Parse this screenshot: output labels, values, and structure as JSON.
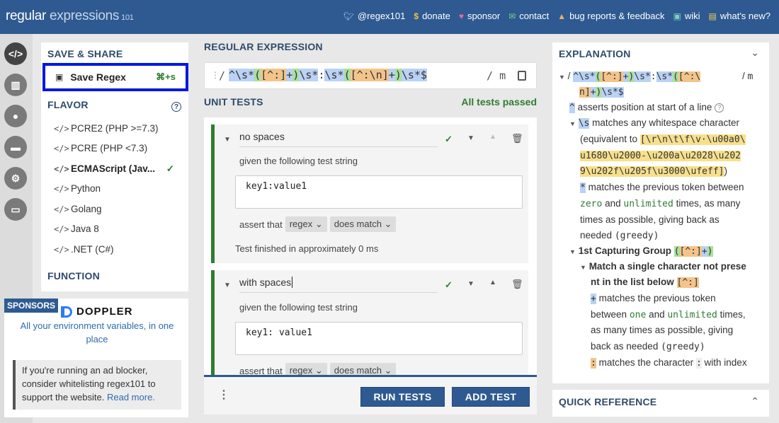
{
  "header": {
    "logo_main": "regular",
    "logo_second": "expressions",
    "logo_version": "101",
    "nav": [
      {
        "icon": "twitter-icon",
        "label": "@regex101"
      },
      {
        "icon": "dollar-icon",
        "label": "donate"
      },
      {
        "icon": "heart-icon",
        "label": "sponsor"
      },
      {
        "icon": "mail-icon",
        "label": "contact"
      },
      {
        "icon": "warning-icon",
        "label": "bug reports & feedback"
      },
      {
        "icon": "wiki-icon",
        "label": "wiki"
      },
      {
        "icon": "whatsnew-icon",
        "label": "what's new?"
      }
    ]
  },
  "left": {
    "save_title": "SAVE & SHARE",
    "save_label": "Save Regex",
    "save_shortcut": "⌘+s",
    "flavor_title": "FLAVOR",
    "flavors": [
      {
        "label": "PCRE2 (PHP >=7.3)",
        "selected": false
      },
      {
        "label": "PCRE (PHP <7.3)",
        "selected": false
      },
      {
        "label": "ECMAScript (Jav...",
        "selected": true
      },
      {
        "label": "Python",
        "selected": false
      },
      {
        "label": "Golang",
        "selected": false
      },
      {
        "label": "Java 8",
        "selected": false
      },
      {
        "label": ".NET (C#)",
        "selected": false
      }
    ],
    "function_title": "FUNCTION"
  },
  "sponsors": {
    "tag": "SPONSORS",
    "brand": "DOPPLER",
    "tagline": "All your environment variables, in one place",
    "adblock_text": "If you're running an ad blocker, consider whitelisting regex101 to support the website.",
    "read_more": "Read more."
  },
  "regex": {
    "title": "REGULAR EXPRESSION",
    "delimiter_open": "/",
    "delimiter_close": "/",
    "flags": "m"
  },
  "unit_tests": {
    "title": "UNIT TESTS",
    "status": "All tests passed",
    "tests": [
      {
        "name": "no spaces",
        "given_label": "given the following test string",
        "test_string": "key1:value1",
        "assert_label": "assert that",
        "subject": "regex",
        "matcher": "does match",
        "result": "Test finished in approximately 0 ms"
      },
      {
        "name": "with spaces",
        "given_label": "given the following test string",
        "test_string": "key1: value1",
        "assert_label": "assert that",
        "subject": "regex",
        "matcher": "does match"
      }
    ],
    "run_label": "RUN TESTS",
    "add_label": "ADD TEST"
  },
  "explanation": {
    "title": "EXPLANATION",
    "flags": "m",
    "l1": "asserts position at start of a line",
    "l2": "matches any whitespace character",
    "l3a": "(equivalent to",
    "l3b": "[\\r\\n\\t\\f\\v·\\u00a0\\",
    "l4": "u1680\\u2000-\\u200a\\u2028\\u202",
    "l5": "9\\u202f\\u205f\\u3000\\ufeff]",
    "l5b": ")",
    "l6": "matches the previous token between",
    "l7a": "zero",
    "l7b": "and",
    "l7c": "unlimited",
    "l7d": "times, as many",
    "l8": "times as possible, giving back as",
    "l9a": "needed",
    "l9b": "(greedy)",
    "l10": "1st Capturing Group",
    "l11": "Match a single character not prese",
    "l12": "nt in the list below",
    "l13": "matches the previous token",
    "l14a": "between",
    "l14b": "one",
    "l14c": "and",
    "l14d": "unlimited",
    "l14e": "times,",
    "l15": "as many times as possible, giving",
    "l16a": "back as needed",
    "l16b": "(greedy)",
    "l17a": "matches the character",
    "l17b": ":",
    "l17c": "with index"
  },
  "quick_reference": {
    "title": "QUICK REFERENCE"
  },
  "colors": {
    "header": "#2e5a91",
    "pass": "#2e7d32",
    "focus": "#0018e0"
  }
}
